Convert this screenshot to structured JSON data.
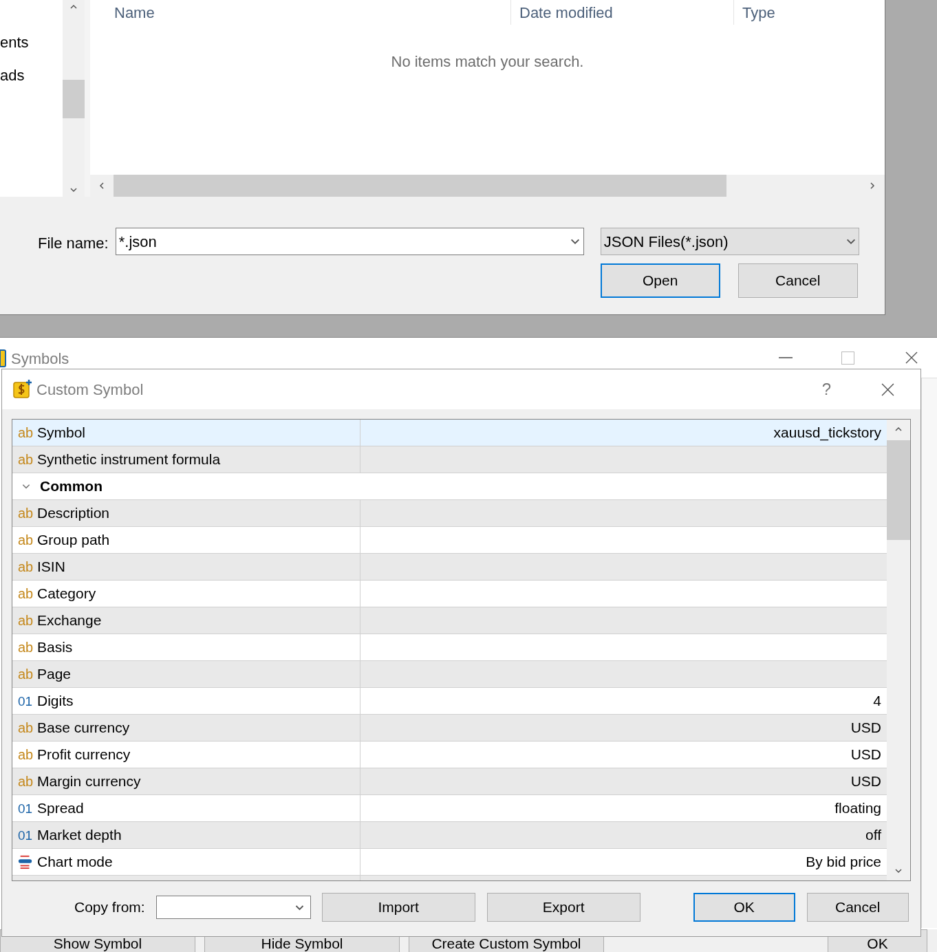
{
  "file_dialog": {
    "nav_items": [
      "ents",
      "ads"
    ],
    "columns": [
      "Name",
      "Date modified",
      "Type"
    ],
    "empty_message": "No items match your search.",
    "file_name_label": "File name:",
    "file_name_value": "*.json",
    "filter": "JSON Files(*.json)",
    "buttons": [
      {
        "label": "Open",
        "default": true
      },
      {
        "label": "Cancel",
        "default": false
      }
    ]
  },
  "symbols_window": {
    "title": "Symbols",
    "buttons": [
      "Show Symbol",
      "Hide Symbol",
      "Create Custom Symbol",
      "OK"
    ]
  },
  "custom_symbol_dialog": {
    "title": "Custom Symbol",
    "help": "?",
    "properties": [
      {
        "kind": "string",
        "type_label": "ab",
        "name": "Symbol",
        "value": "xauusd_tickstory",
        "selected": true
      },
      {
        "kind": "string",
        "type_label": "ab",
        "name": "Synthetic instrument formula",
        "selected": false
      },
      {
        "kind": "group",
        "name": "Common",
        "expanded": true,
        "selected": false,
        "children": [
          {
            "kind": "string",
            "type_label": "ab",
            "name": "Description",
            "selected": false
          },
          {
            "kind": "string",
            "type_label": "ab",
            "name": "Group path",
            "selected": false
          },
          {
            "kind": "string",
            "type_label": "ab",
            "name": "ISIN",
            "selected": false
          },
          {
            "kind": "string",
            "type_label": "ab",
            "name": "Category",
            "selected": false
          },
          {
            "kind": "string",
            "type_label": "ab",
            "name": "Exchange",
            "selected": false
          },
          {
            "kind": "string",
            "type_label": "ab",
            "name": "Basis",
            "selected": false
          },
          {
            "kind": "string",
            "type_label": "ab",
            "name": "Page",
            "selected": false
          },
          {
            "kind": "number",
            "type_label": "01",
            "name": "Digits",
            "value": "4",
            "selected": false
          },
          {
            "kind": "string",
            "type_label": "ab",
            "name": "Base currency",
            "value": "USD",
            "selected": false
          },
          {
            "kind": "string",
            "type_label": "ab",
            "name": "Profit currency",
            "value": "USD",
            "selected": false
          },
          {
            "kind": "string",
            "type_label": "ab",
            "name": "Margin currency",
            "value": "USD",
            "selected": false
          },
          {
            "kind": "number",
            "type_label": "01",
            "name": "Spread",
            "value": "floating",
            "selected": false
          },
          {
            "kind": "number",
            "type_label": "01",
            "name": "Market depth",
            "value": "off",
            "selected": false
          },
          {
            "kind": "enum",
            "name": "Chart mode",
            "value": "By bid price",
            "selected": false
          }
        ]
      }
    ],
    "copy_from_label": "Copy from:",
    "buttons": [
      {
        "label": "Import",
        "default": false
      },
      {
        "label": "Export",
        "default": false
      },
      {
        "label": "OK",
        "default": true
      },
      {
        "label": "Cancel",
        "default": false
      }
    ]
  }
}
